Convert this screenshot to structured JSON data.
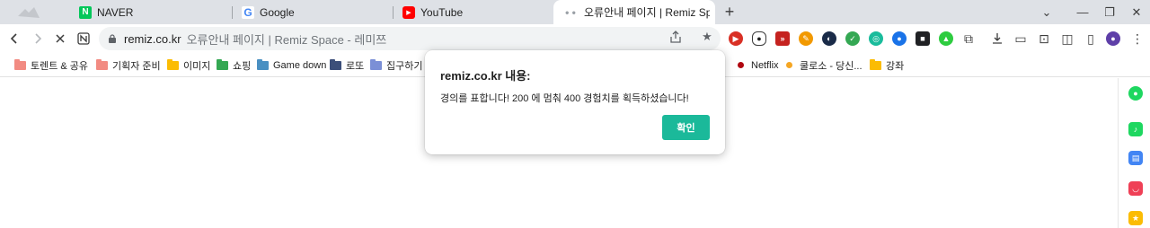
{
  "tabs": [
    {
      "title": "NAVER",
      "favicon": "naver-icon",
      "color": "#03c75a",
      "glyph": "N"
    },
    {
      "title": "Google",
      "favicon": "google-icon",
      "color": "#4285f4",
      "glyph": "G"
    },
    {
      "title": "YouTube",
      "favicon": "youtube-icon",
      "color": "#ff0000",
      "glyph": "▶"
    },
    {
      "title": "오류안내 페이지 | Remiz Space",
      "favicon": "loading-icon",
      "active": true
    }
  ],
  "omnibox": {
    "host": "remiz.co.kr",
    "rest": "오류안내 페이지 | Remiz Space - 레미쯔"
  },
  "bookmarks": [
    {
      "label": "토렌트 & 공유",
      "color": "#f28b82",
      "kind": "folder"
    },
    {
      "label": "기획자 준비",
      "color": "#f28b82",
      "kind": "folder"
    },
    {
      "label": "이미지",
      "color": "#fbbc04",
      "kind": "folder"
    },
    {
      "label": "쇼핑",
      "color": "#34a853",
      "kind": "folder"
    },
    {
      "label": "Game down",
      "color": "#4a90c2",
      "kind": "folder"
    },
    {
      "label": "로또",
      "color": "#3c4f7a",
      "kind": "folder"
    },
    {
      "label": "집구하기",
      "color": "#7b8fd6",
      "kind": "folder"
    },
    {
      "label": "Netflix",
      "color": "#b00610",
      "kind": "dot"
    },
    {
      "label": "쿨로소 - 당신...",
      "color": "#f5a623",
      "kind": "dot"
    },
    {
      "label": "강좌",
      "color": "#fbbc04",
      "kind": "folder"
    }
  ],
  "dialog": {
    "title": "remiz.co.kr 내용:",
    "message": "경의를 표합니다! 200 에 멈춰 400 경험치를 획득하셨습니다!",
    "ok_label": "확인",
    "accent": "#1bb99a"
  }
}
